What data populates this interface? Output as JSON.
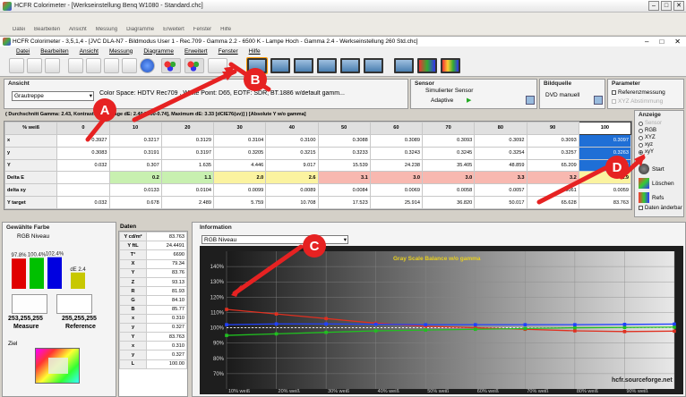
{
  "outer_window": {
    "title": "HCFR Colorimeter - [Werkseinstellung Benq W1080 - Standard.chc]",
    "menu": [
      "Datei",
      "Bearbeiten",
      "Ansicht",
      "Messung",
      "Diagramme",
      "Erweitert",
      "Fenster",
      "Hilfe"
    ]
  },
  "inner_window": {
    "title": "HCFR Colorimeter - 3,5,1,4 - [JVC DLA-N7 - Bildmodus User 1 - Rec.709 - Gamma 2.2 - 6500 K - Lampe Hoch - Gamma 2.4 - Werkseinstellung 260 Std.chc]",
    "controls": [
      "–",
      "□",
      "✕"
    ]
  },
  "menu": [
    "Datei",
    "Bearbeiten",
    "Ansicht",
    "Messung",
    "Diagramme",
    "Erweitert",
    "Fenster",
    "Hilfe"
  ],
  "ansicht": {
    "label": "Ansicht",
    "select": "Grautreppe",
    "reference": "Color Space: HDTV Rec709 , White Point: D65, EOTF:  SDR, BT.1886 w/default gamm..."
  },
  "sensor": {
    "label": "Sensor",
    "name": "Simulierter Sensor",
    "mode": "Adaptive"
  },
  "bildquelle": {
    "label": "Bildquelle",
    "name": "DVD manuell"
  },
  "parameter": {
    "label": "Parameter",
    "opt1": "Referenzmessung",
    "opt2": "XYZ Abstimmung"
  },
  "summary": "( Durchschnitt Gamma: 2.43, Kontrast: ..., Average dE: 2.40 [0.00-0.74], Maximum dE: 3.33 [dCIE76(uv)] ) [Absolute Y w/o gamma]",
  "grid": {
    "header": [
      "% weiß",
      "0",
      "10",
      "20",
      "30",
      "40",
      "50",
      "60",
      "70",
      "80",
      "90",
      "100"
    ],
    "rows": [
      {
        "label": "x",
        "cells": [
          "0.3927",
          "0.3217",
          "0.3129",
          "0.3104",
          "0.3100",
          "0.3088",
          "0.3089",
          "0.3093",
          "0.3092",
          "0.3093",
          "0.3097"
        ]
      },
      {
        "label": "y",
        "cells": [
          "0.3083",
          "0.3191",
          "0.3197",
          "0.3205",
          "0.3215",
          "0.3233",
          "0.3243",
          "0.3245",
          "0.3254",
          "0.3257",
          "0.3263"
        ]
      },
      {
        "label": "Y",
        "cells": [
          "0.032",
          "0.307",
          "1.635",
          "4.446",
          "9.017",
          "15.539",
          "24.238",
          "35.405",
          "48.859",
          "65.209",
          "83.763"
        ]
      },
      {
        "label": "Delta E",
        "cells": [
          "",
          "0.2",
          "1.1",
          "2.0",
          "2.6",
          "3.1",
          "3.0",
          "3.0",
          "3.3",
          "3.2",
          "1.9"
        ]
      },
      {
        "label": "delta xy",
        "cells": [
          "",
          "0.0133",
          "0.0104",
          "0.0099",
          "0.0089",
          "0.0084",
          "0.0069",
          "0.0058",
          "0.0057",
          "0.0061",
          "0.0059"
        ]
      },
      {
        "label": "Y target",
        "cells": [
          "0.032",
          "0.678",
          "2.489",
          "5.759",
          "10.708",
          "17.523",
          "25.914",
          "36.820",
          "50.017",
          "65.628",
          "83.763"
        ]
      }
    ]
  },
  "anzeige": {
    "label": "Anzeige",
    "options": [
      "Sensor",
      "RGB",
      "XYZ",
      "xyz",
      "xyY"
    ],
    "selected": "xyY",
    "start": "Start",
    "loeschen": "Löschen",
    "refs": "Refs",
    "daten_label": "Daten änderbar"
  },
  "farbe": {
    "label": "Gewählte Farbe",
    "sub": "RGB Niveau",
    "bars": [
      {
        "label": "97.8%",
        "value": 97.8,
        "color": "#e00000"
      },
      {
        "label": "100.4%",
        "value": 100.4,
        "color": "#00c000"
      },
      {
        "label": "102.4%",
        "value": 102.4,
        "color": "#0000e0"
      }
    ],
    "de_label": "dE 2.4",
    "de_value": 2.4,
    "measure_value": "253,255,255",
    "measure_label": "Measure",
    "reference_value": "255,255,255",
    "reference_label": "Reference",
    "ziel": "Ziel"
  },
  "daten": {
    "label": "Daten",
    "rows": [
      {
        "k": "Y cd/m²",
        "v": "83.763"
      },
      {
        "k": "Y ftL",
        "v": "24.4491"
      },
      {
        "k": "T°",
        "v": "6690"
      },
      {
        "k": "X",
        "v": "79.34"
      },
      {
        "k": "Y",
        "v": "83.76"
      },
      {
        "k": "Z",
        "v": "93.13"
      },
      {
        "k": "R",
        "v": "81.93"
      },
      {
        "k": "G",
        "v": "84.10"
      },
      {
        "k": "B",
        "v": "85.77"
      },
      {
        "k": "x",
        "v": "0.310"
      },
      {
        "k": "y",
        "v": "0.327"
      },
      {
        "k": "Y",
        "v": "83.763"
      },
      {
        "k": "x",
        "v": "0.310"
      },
      {
        "k": "y",
        "v": "0.327"
      },
      {
        "k": "L",
        "v": "100.00"
      }
    ]
  },
  "info": {
    "label": "Information",
    "select": "RGB Niveau"
  },
  "chart_data": {
    "type": "line",
    "title": "Gray Scale Balance w/o gamma",
    "watermark": "hcfr.sourceforge.net",
    "x": [
      10,
      20,
      30,
      40,
      50,
      60,
      70,
      80,
      90,
      100
    ],
    "x_labels": [
      "10% weiß",
      "20% weiß",
      "30% weiß",
      "40% weiß",
      "50% weiß",
      "60% weiß",
      "70% weiß",
      "80% weiß",
      "90% weiß"
    ],
    "ylim": [
      60,
      150
    ],
    "y_ticks": [
      140,
      130,
      120,
      110,
      100,
      90,
      80,
      70
    ],
    "series": [
      {
        "name": "R",
        "color": "#e03020",
        "values": [
          112,
          109,
          106,
          103,
          101,
          100,
          99,
          98,
          97.5,
          97.8
        ]
      },
      {
        "name": "G",
        "color": "#20c020",
        "values": [
          95,
          96,
          97,
          98,
          98.5,
          99,
          99.5,
          100,
          100.2,
          100.4
        ]
      },
      {
        "name": "B",
        "color": "#2040ff",
        "values": [
          102,
          102.5,
          102.5,
          102.3,
          102,
          102,
          102,
          102,
          102.2,
          102.4
        ]
      }
    ]
  },
  "annotations": [
    "A",
    "B",
    "C",
    "D"
  ]
}
